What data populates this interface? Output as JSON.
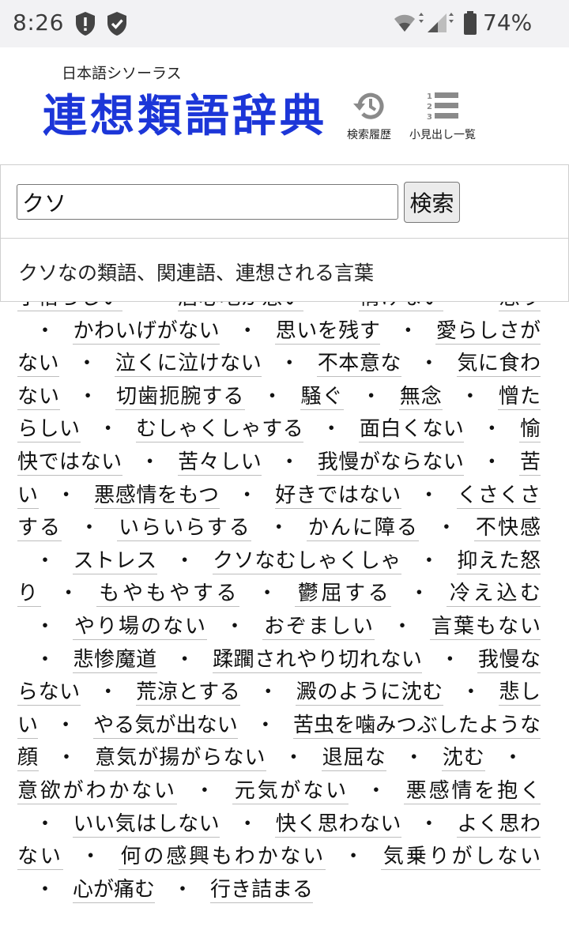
{
  "status_bar": {
    "time": "8:26",
    "battery": "74%"
  },
  "header": {
    "subtitle": "日本語シソーラス",
    "logo": "連想類語辞典",
    "history_label": "検索履歴",
    "index_label": "小見出し一覧",
    "brand_color": "#1c36d8"
  },
  "search": {
    "value": "クソ",
    "button": "検索"
  },
  "result_heading": "クソなの類語、関連語、連想される言葉",
  "words": [
    "小憎らしい",
    "居心地が悪い",
    "情けない",
    "怒り",
    "かわいげがない",
    "思いを残す",
    "愛らしさがない",
    "泣くに泣けない",
    "不本意な",
    "気に食わない",
    "切歯扼腕する",
    "騒ぐ",
    "無念",
    "憎たらしい",
    "むしゃくしゃする",
    "面白くない",
    "愉快ではない",
    "苦々しい",
    "我慢がならない",
    "苦い",
    "悪感情をもつ",
    "好きではない",
    "くさくさする",
    "いらいらする",
    "かんに障る",
    "不快感",
    "ストレス",
    "クソなむしゃくしゃ",
    "抑えた怒り",
    "もやもやする",
    "鬱屈する",
    "冷え込む",
    "やり場のない",
    "おぞましい",
    "言葉もない",
    "悲惨魔道",
    "蹂躙されやり切れない",
    "我慢ならない",
    "荒涼とする",
    "澱のように沈む",
    "悲しい",
    "やる気が出ない",
    "苦虫を噛みつぶしたような顔",
    "意気が揚がらない",
    "退屈な",
    "沈む",
    "意欲がわかない",
    "元気がない",
    "悪感情を抱く",
    "いい気はしない",
    "快く思わない",
    "よく思わない",
    "何の感興もわかない",
    "気乗りがしない",
    "心が痛む",
    "行き詰まる"
  ]
}
